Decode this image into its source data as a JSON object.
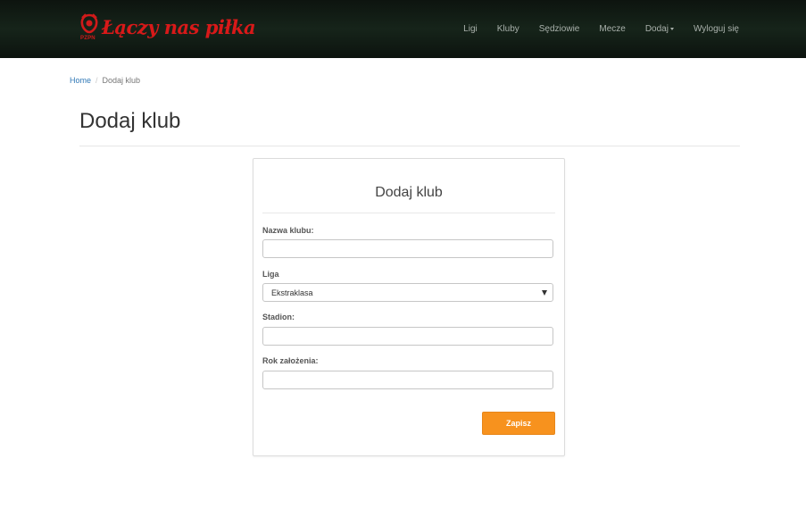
{
  "navbar": {
    "brand": {
      "emblem_text": "PZPN",
      "title": "Łączy nas piłka"
    },
    "items": [
      {
        "label": "Ligi"
      },
      {
        "label": "Kluby"
      },
      {
        "label": "Sędziowie"
      },
      {
        "label": "Mecze"
      },
      {
        "label": "Dodaj",
        "dropdown": true
      },
      {
        "label": "Wyloguj się"
      }
    ]
  },
  "breadcrumb": {
    "home": "Home",
    "separator": "/",
    "current": "Dodaj klub"
  },
  "page": {
    "title": "Dodaj klub"
  },
  "form": {
    "title": "Dodaj klub",
    "fields": {
      "name": {
        "label": "Nazwa klubu:",
        "value": ""
      },
      "league": {
        "label": "Liga",
        "value": "Ekstraklasa"
      },
      "stadium": {
        "label": "Stadion:",
        "value": ""
      },
      "founded": {
        "label": "Rok założenia:",
        "value": ""
      }
    },
    "submit_label": "Zapisz"
  },
  "colors": {
    "brand_red": "#d81919",
    "navbar_bg": "#121d15",
    "accent_orange": "#f7921e",
    "link_blue": "#337ab7"
  }
}
